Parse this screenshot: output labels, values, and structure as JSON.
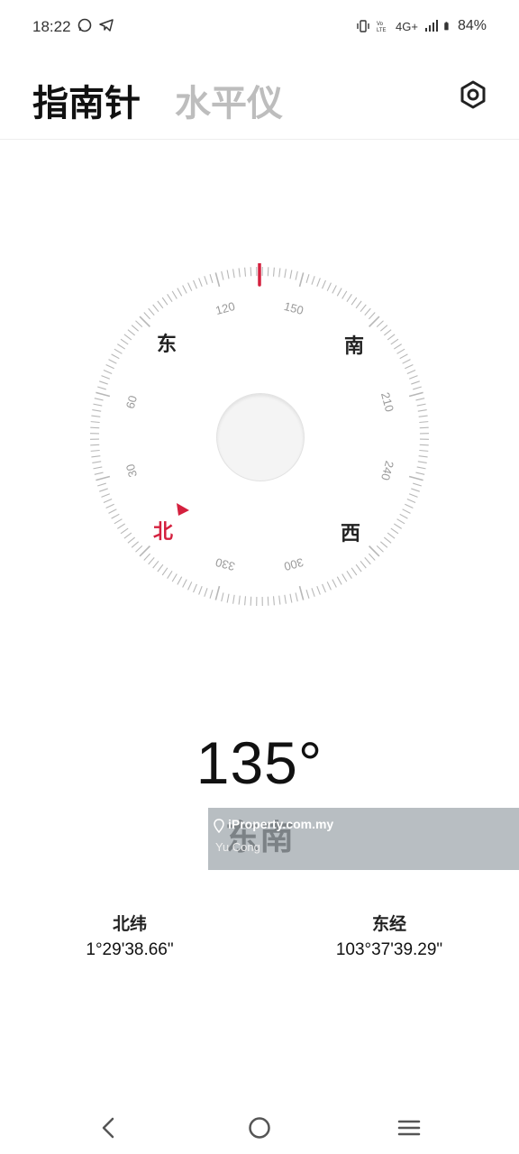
{
  "status_bar": {
    "time": "18:22",
    "left_icons": [
      "whatsapp-icon",
      "telegram-icon"
    ],
    "right_icons": [
      "vibrate-icon",
      "volte-icon",
      "network-4g-icon",
      "signal-icon",
      "battery-icon"
    ],
    "network": "4G+",
    "battery": "84%"
  },
  "header": {
    "tabs": [
      {
        "label": "指南针",
        "active": true
      },
      {
        "label": "水平仪",
        "active": false
      }
    ],
    "settings_icon": "settings-icon"
  },
  "compass": {
    "heading_degrees": 135,
    "cardinals": {
      "north": "北",
      "east": "东",
      "south": "南",
      "west": "西"
    },
    "tick_labels": [
      "120",
      "150",
      "210",
      "240",
      "300",
      "330",
      "30",
      "60"
    ],
    "accent_color": "#d4203e"
  },
  "readout": {
    "degree": "135°",
    "direction": "东南"
  },
  "watermark": {
    "line1": "iProperty.com.my",
    "line2": "Yu Cong"
  },
  "coordinates": {
    "latitude_label": "北纬",
    "latitude_value": "1°29'38.66\"",
    "longitude_label": "东经",
    "longitude_value": "103°37'39.29\""
  },
  "nav_bar": {
    "buttons": [
      "back-icon",
      "home-icon",
      "recents-icon"
    ]
  }
}
